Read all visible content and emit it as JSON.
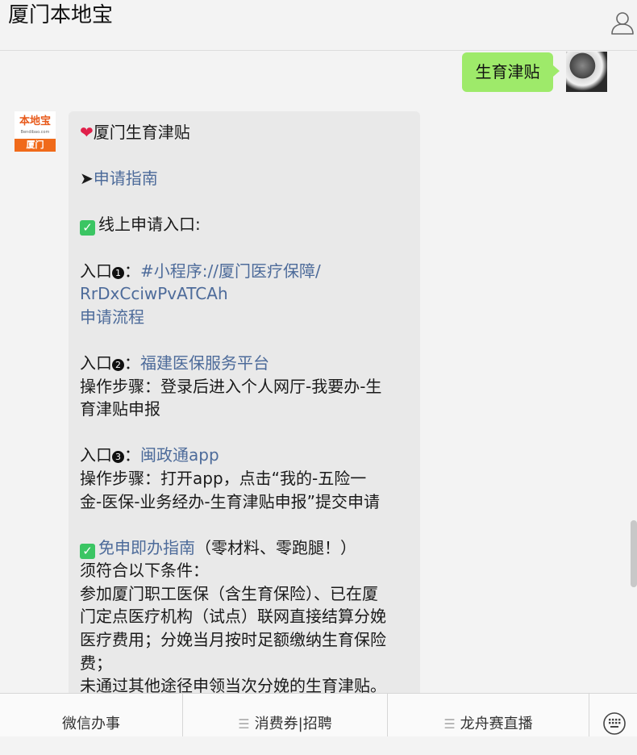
{
  "header": {
    "title": "厦门本地宝",
    "profile_icon": "person-icon"
  },
  "user_message": {
    "text": "生育津贴"
  },
  "bot": {
    "avatar_brand": "本地宝",
    "avatar_domain": "Bendibao.com",
    "avatar_city": "厦门",
    "title": "厦门生育津贴",
    "guide_arrow": "➤",
    "guide_link": "申请指南",
    "online_entry_heading": "线上申请入口:",
    "entry1_label": "入口",
    "entry1_num": "1",
    "entry1_sep": "：",
    "entry1_link_a": "#小程序://厦门医疗保障/",
    "entry1_link_b": "RrDxCciwPvATCAh",
    "entry1_link_c": "申请流程",
    "entry2_label": "入口",
    "entry2_num": "2",
    "entry2_sep": "：",
    "entry2_link": "福建医保服务平台",
    "entry2_steps_a": "操作步骤：登录后进入个人网厅-我要办-生",
    "entry2_steps_b": "育津贴申报",
    "entry3_label": "入口",
    "entry3_num": "3",
    "entry3_sep": "：",
    "entry3_link": "闽政通app",
    "entry3_steps_a": "操作步骤：打开app，点击“我的-五险一",
    "entry3_steps_b": "金-医保-业务经办-生育津贴申报”提交申请",
    "exempt_link": "免申即办指南",
    "exempt_note": "（零材料、零跑腿！）",
    "cond_heading": "须符合以下条件：",
    "cond_a": "参加厦门职工医保（含生育保险）、已在厦",
    "cond_b": "门定点医疗机构（试点）联网直接结算分娩",
    "cond_c": "医疗费用；分娩当月按时足额缴纳生育保险",
    "cond_d": "费；",
    "cond_e": "未通过其他途径申领当次分娩的生育津贴。"
  },
  "bottom_menu": {
    "item1": "微信办事",
    "item2": "消费券|招聘",
    "item3": "龙舟赛直播",
    "menu_icon": "hamburger-icon",
    "keyboard_icon": "keyboard-icon"
  },
  "colors": {
    "user_bubble": "#9eea6a",
    "bot_bubble": "#e9e9e9",
    "link": "#4d6b9a",
    "check": "#3bc563",
    "brand_orange": "#f06a1a"
  }
}
